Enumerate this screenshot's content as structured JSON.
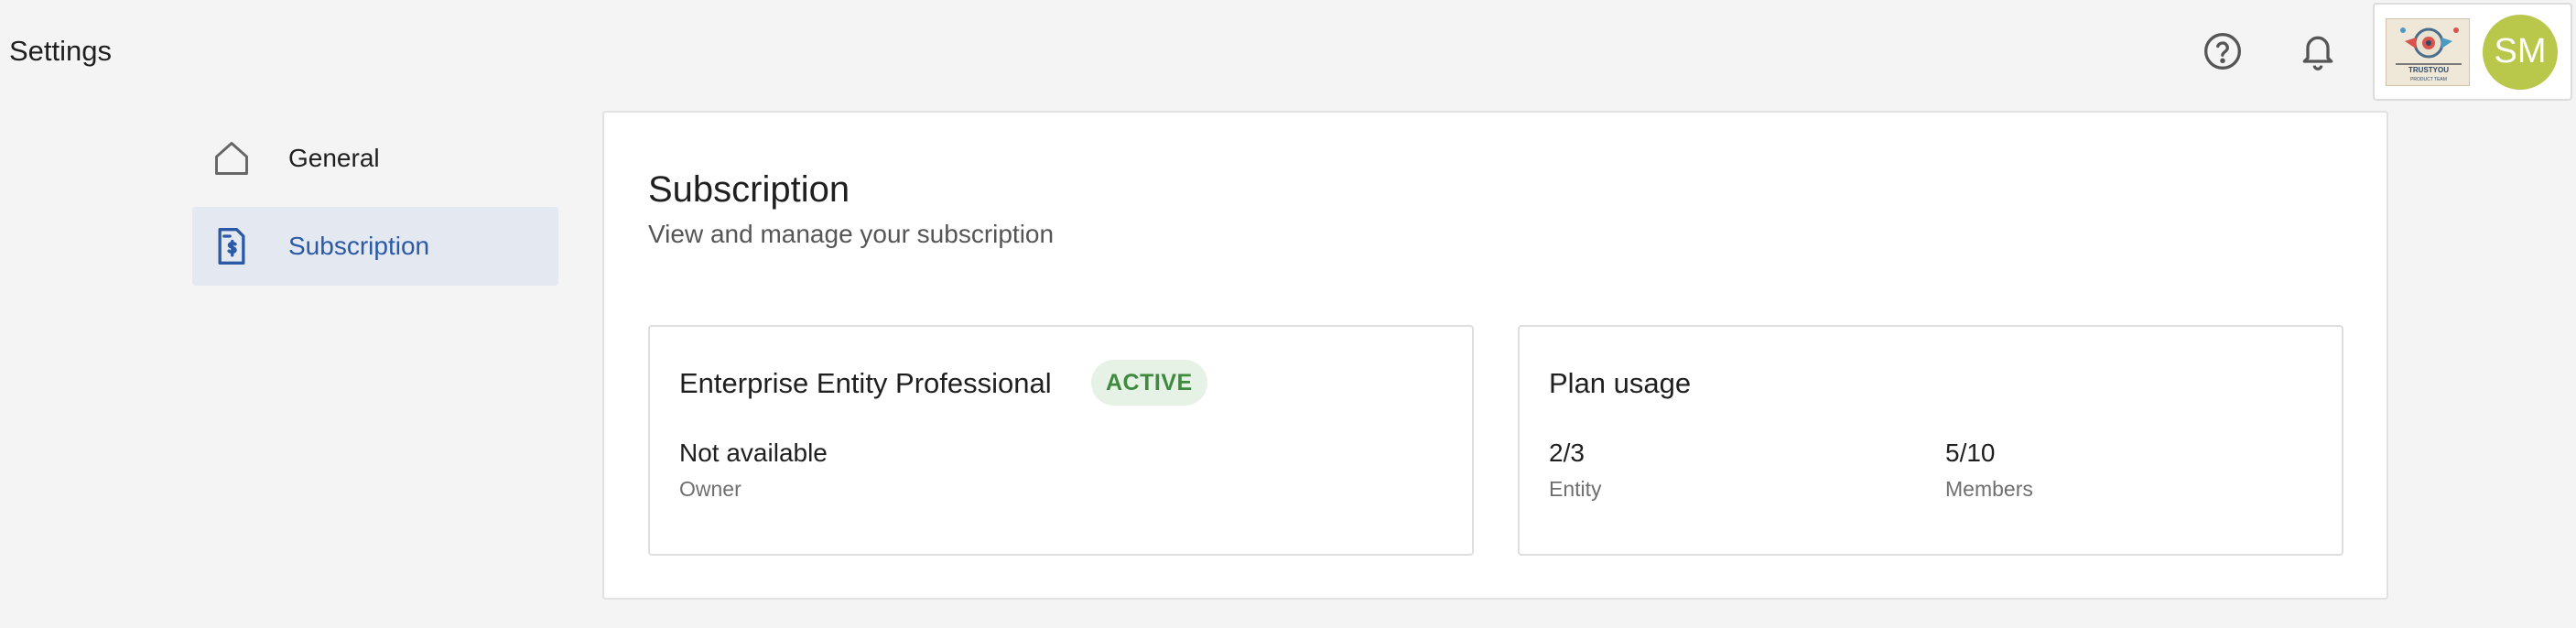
{
  "page": {
    "title": "Settings"
  },
  "topbar": {
    "help_icon": "help-circle-icon",
    "notifications_icon": "bell-icon",
    "org_logo_text": "TRUSTYOU",
    "org_logo_subtext": "PRODUCT TEAM",
    "avatar_initials": "SM",
    "avatar_color": "#b9c74a"
  },
  "sidebar": {
    "items": [
      {
        "label": "General",
        "icon": "home-icon",
        "active": false
      },
      {
        "label": "Subscription",
        "icon": "invoice-dollar-icon",
        "active": true
      }
    ]
  },
  "subscription": {
    "title": "Subscription",
    "subtitle": "View and manage your subscription",
    "plan": {
      "name": "Enterprise Entity Professional",
      "status": "ACTIVE",
      "owner_value": "Not available",
      "owner_label": "Owner"
    },
    "usage": {
      "title": "Plan usage",
      "entity_value": "2/3",
      "entity_label": "Entity",
      "members_value": "5/10",
      "members_label": "Members"
    }
  },
  "colors": {
    "accent": "#2a59a6",
    "active_nav_bg": "#e4e8f1",
    "badge_bg": "#e6f2e6",
    "badge_text": "#3f8a3f"
  }
}
